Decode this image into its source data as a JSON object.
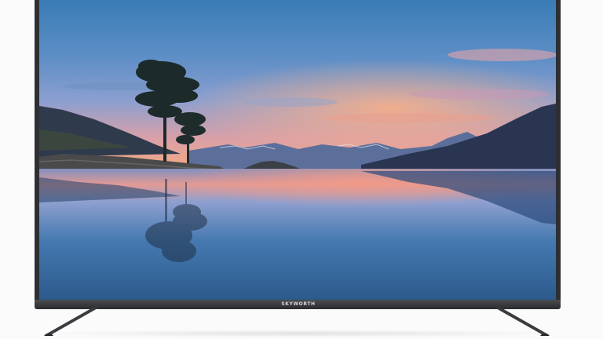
{
  "image": {
    "subject": "flat-screen-television",
    "brand_logo_text": "SKYWORTH"
  },
  "palette": {
    "sky_top": "#3d7fb8",
    "sky_mid": "#7f9fd0",
    "sunset": "#f2a07a",
    "mountain": "#2b3550",
    "water": "#2f5d8e",
    "bezel": "#2d2f33",
    "background": "#fbfbfb"
  }
}
